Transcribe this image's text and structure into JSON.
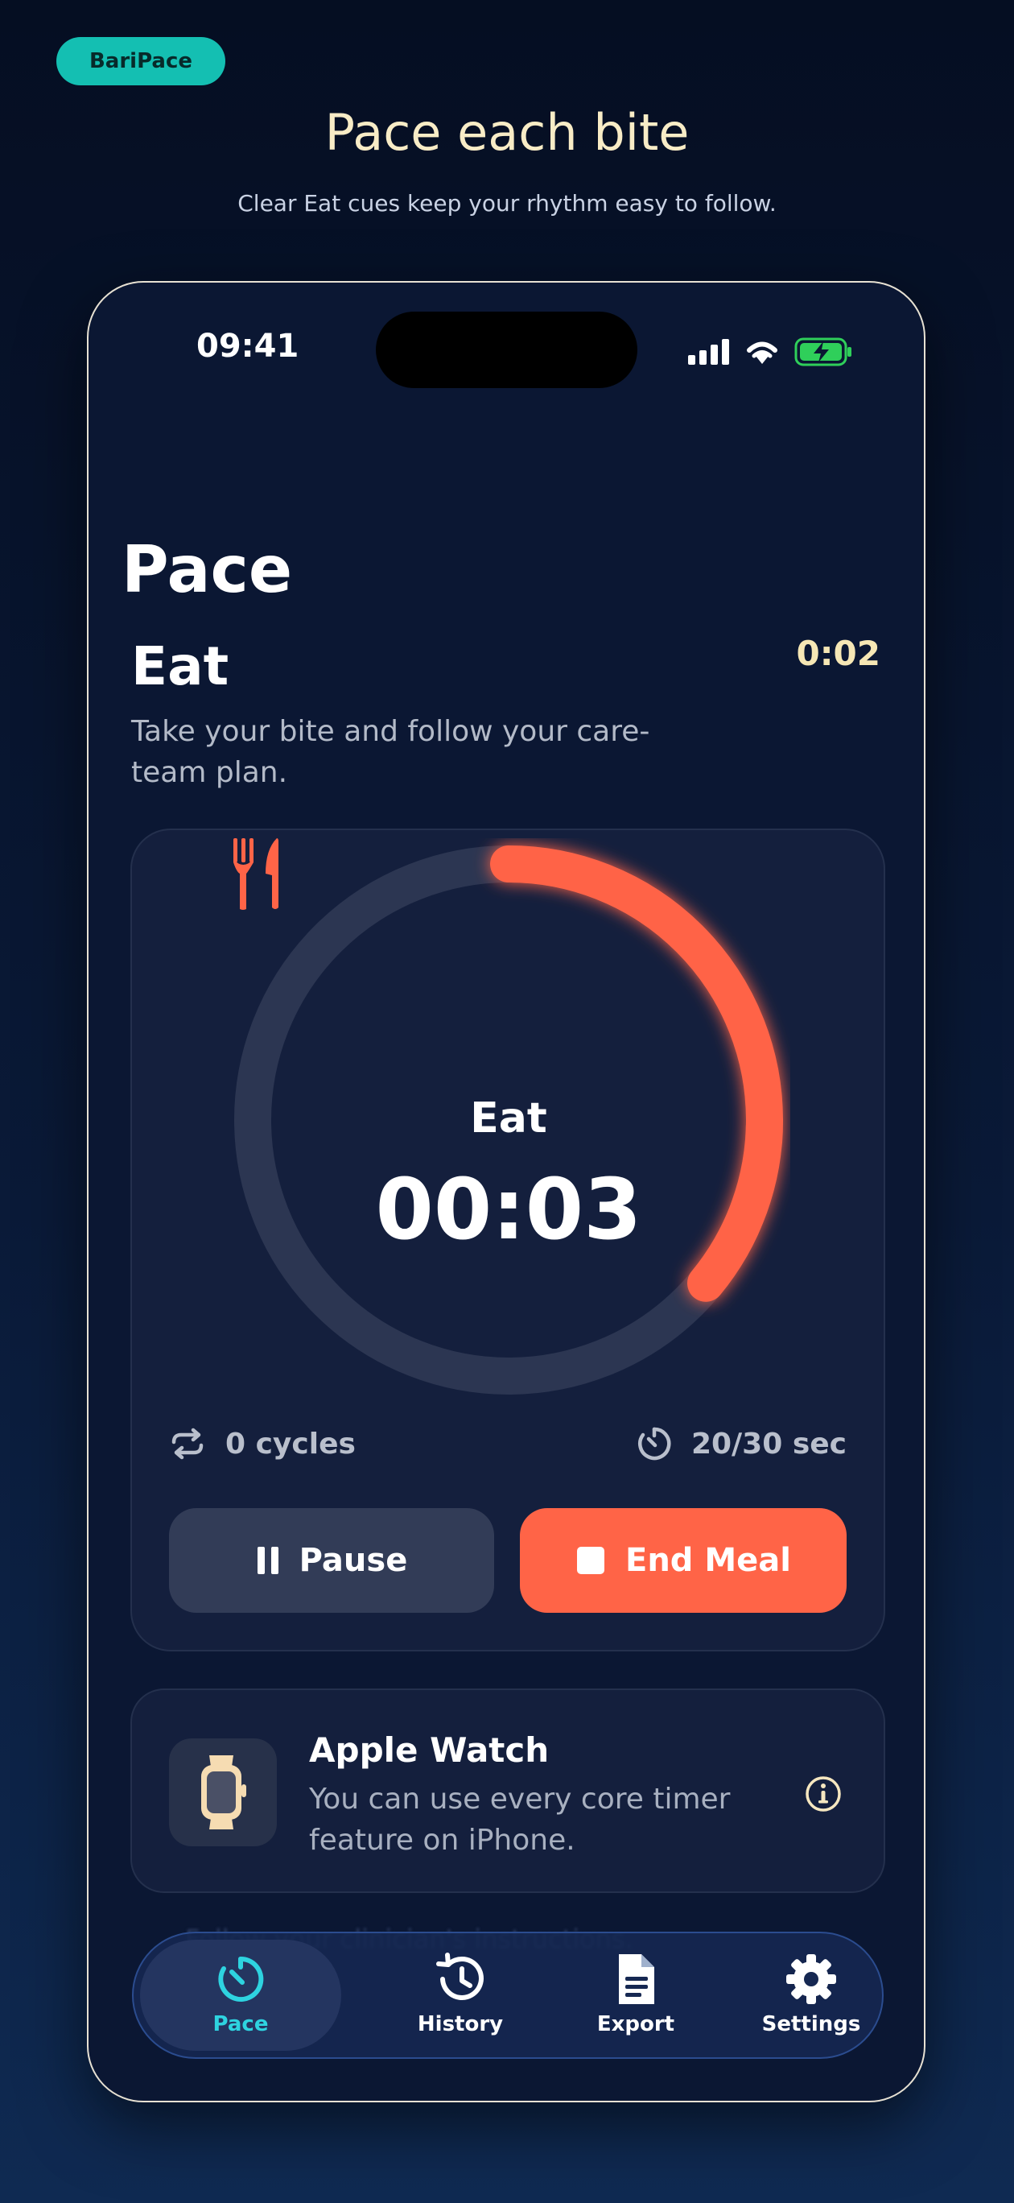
{
  "badge": "BariPace",
  "headline": "Pace each bite",
  "subheadline": "Clear Eat cues keep your rhythm easy to follow.",
  "status_bar": {
    "time": "09:41"
  },
  "screen": {
    "title": "Pace",
    "phase_title": "Eat",
    "elapsed": "0:02",
    "instruction": "Take your bite and follow your care-team plan."
  },
  "timer": {
    "phase_label": "Eat",
    "countdown": "00:03",
    "progress_fraction": 0.36,
    "cycles": "0 cycles",
    "interval": "20/30 sec",
    "pause_label": "Pause",
    "end_label": "End Meal"
  },
  "watch_card": {
    "title": "Apple Watch",
    "description": "You can use every core timer feature on iPhone."
  },
  "tabbar": {
    "behind_text": "Follow your clinician's instructions.",
    "tabs": [
      {
        "label": "Pace",
        "icon": "timer-icon",
        "active": true
      },
      {
        "label": "History",
        "icon": "history-icon",
        "active": false
      },
      {
        "label": "Export",
        "icon": "document-icon",
        "active": false
      },
      {
        "label": "Settings",
        "icon": "gear-icon",
        "active": false
      }
    ]
  },
  "colors": {
    "accent": "#ff6447",
    "teal": "#14bfb2",
    "active_tab": "#2ed3e0",
    "elapsed": "#f6e7b5",
    "card": "#141f3d"
  }
}
